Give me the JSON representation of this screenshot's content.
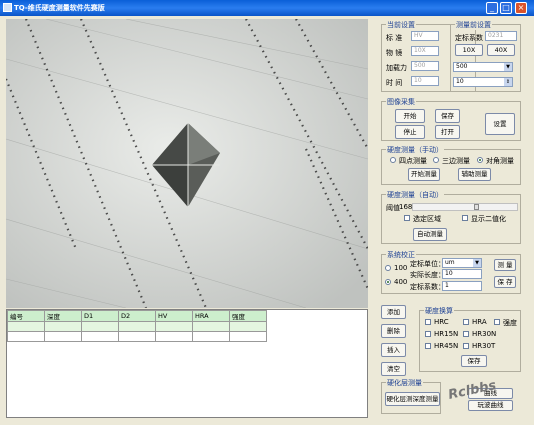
{
  "window": {
    "title": "TQ-维氏硬度测量软件先赛版"
  },
  "table": {
    "headers": [
      "编号",
      "深度",
      "D1",
      "D2",
      "HV",
      "HRA",
      "强度"
    ],
    "rows": [
      [
        "",
        "",
        "",
        "",
        "",
        "",
        ""
      ],
      [
        "",
        "",
        "",
        "",
        "",
        "",
        ""
      ]
    ]
  },
  "current_settings": {
    "caption": "当前设置",
    "standard_label": "标 准",
    "standard_value": "HV",
    "objective_label": "物 镜",
    "objective_value": "10X",
    "load_label": "加载力",
    "load_value": "500",
    "time_label": "时 间",
    "time_value": "10"
  },
  "pre_measure": {
    "caption": "测量前设置",
    "calib_label": "定标系数",
    "calib_value": "0231",
    "btn_10x": "10X",
    "btn_40x": "40X",
    "load_select": "500",
    "time_value": "10"
  },
  "image_capture": {
    "caption": "图像采集",
    "open": "开始",
    "save": "保存",
    "stop": "停止",
    "openfile": "打开",
    "settings": "设置"
  },
  "manual": {
    "caption": "硬度测量（手动）",
    "opt1": "四点测量",
    "opt2": "三边测量",
    "opt3": "对角测量",
    "start": "开始测量",
    "assist": "辅助测量"
  },
  "auto": {
    "caption": "硬度测量（自动）",
    "threshold_label": "阈值",
    "threshold_value": "168",
    "threshold_level": 0.62,
    "chk_region": "选定区域",
    "chk_binary": "显示二值化",
    "auto_btn": "自动测量"
  },
  "calibration": {
    "caption": "系统校正",
    "r100": "100",
    "r400": "400",
    "unit_label": "定标单位：",
    "unit_value": "um",
    "length_label": "实际长度：",
    "length_value": "10",
    "coef_label": "定标系数：",
    "coef_value": "1",
    "measure": "测 量",
    "save": "保 存"
  },
  "actions": {
    "add": "添加",
    "delete": "删除",
    "insert": "插入",
    "clear": "清空"
  },
  "conversion": {
    "caption": "硬度换算",
    "items": [
      "HRC",
      "HRA",
      "强度",
      "HR15N",
      "HR30N",
      "HR45N",
      "HR30T"
    ],
    "save": "保存"
  },
  "layer": {
    "caption": "硬化层测量",
    "btn": "硬化层测深度测量"
  },
  "report": {
    "btn_fragment": "曲线",
    "btn2": "玩波曲线"
  },
  "watermark": "Rclbbs"
}
